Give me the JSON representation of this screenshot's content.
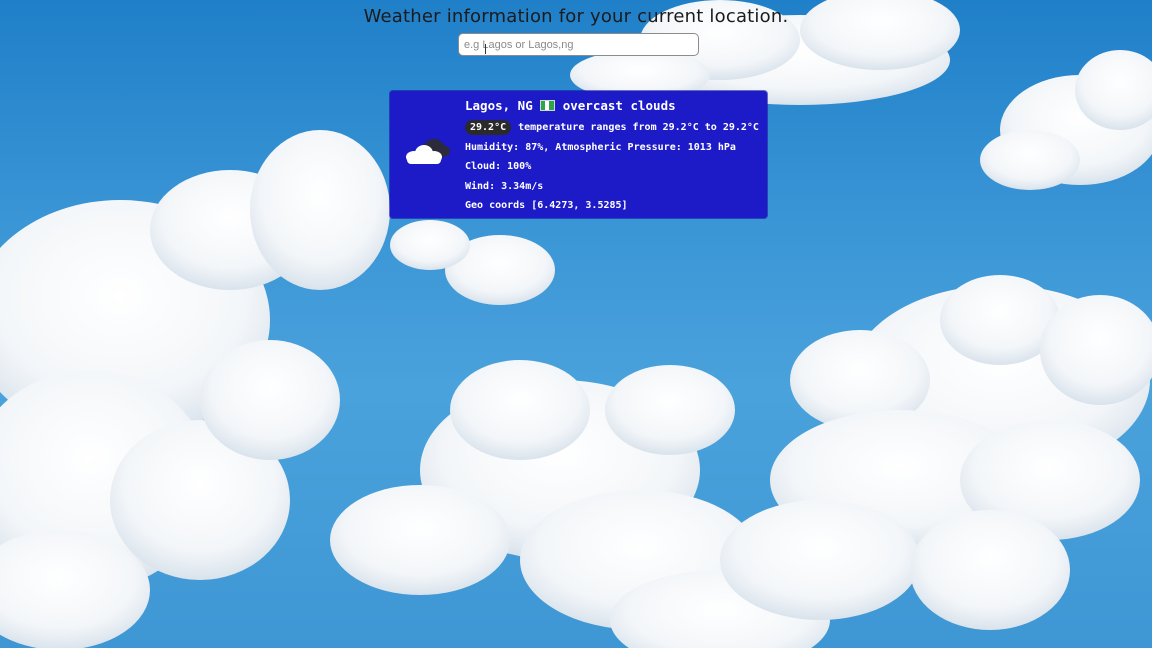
{
  "page": {
    "headline": "Weather information for your current location."
  },
  "search": {
    "placeholder": "e.g Lagos or Lagos,ng",
    "value": ""
  },
  "weather_card": {
    "icon": "overcast-clouds-icon",
    "city": "Lagos, NG",
    "flag": "nigeria-flag-icon",
    "description": "overcast clouds",
    "temperature": "29.2°C",
    "temperature_range": "temperature ranges from 29.2°C to 29.2°C",
    "humidity_pressure": "Humidity: 87%, Atmospheric Pressure: 1013 hPa",
    "cloud": "Cloud: 100%",
    "wind": "Wind: 3.34m/s",
    "geo_coords": "Geo coords [6.4273, 3.5285]"
  },
  "colors": {
    "card_background": "#1d1ac7",
    "temp_badge": "#2a2a2a",
    "sky": "#3b96d6"
  }
}
